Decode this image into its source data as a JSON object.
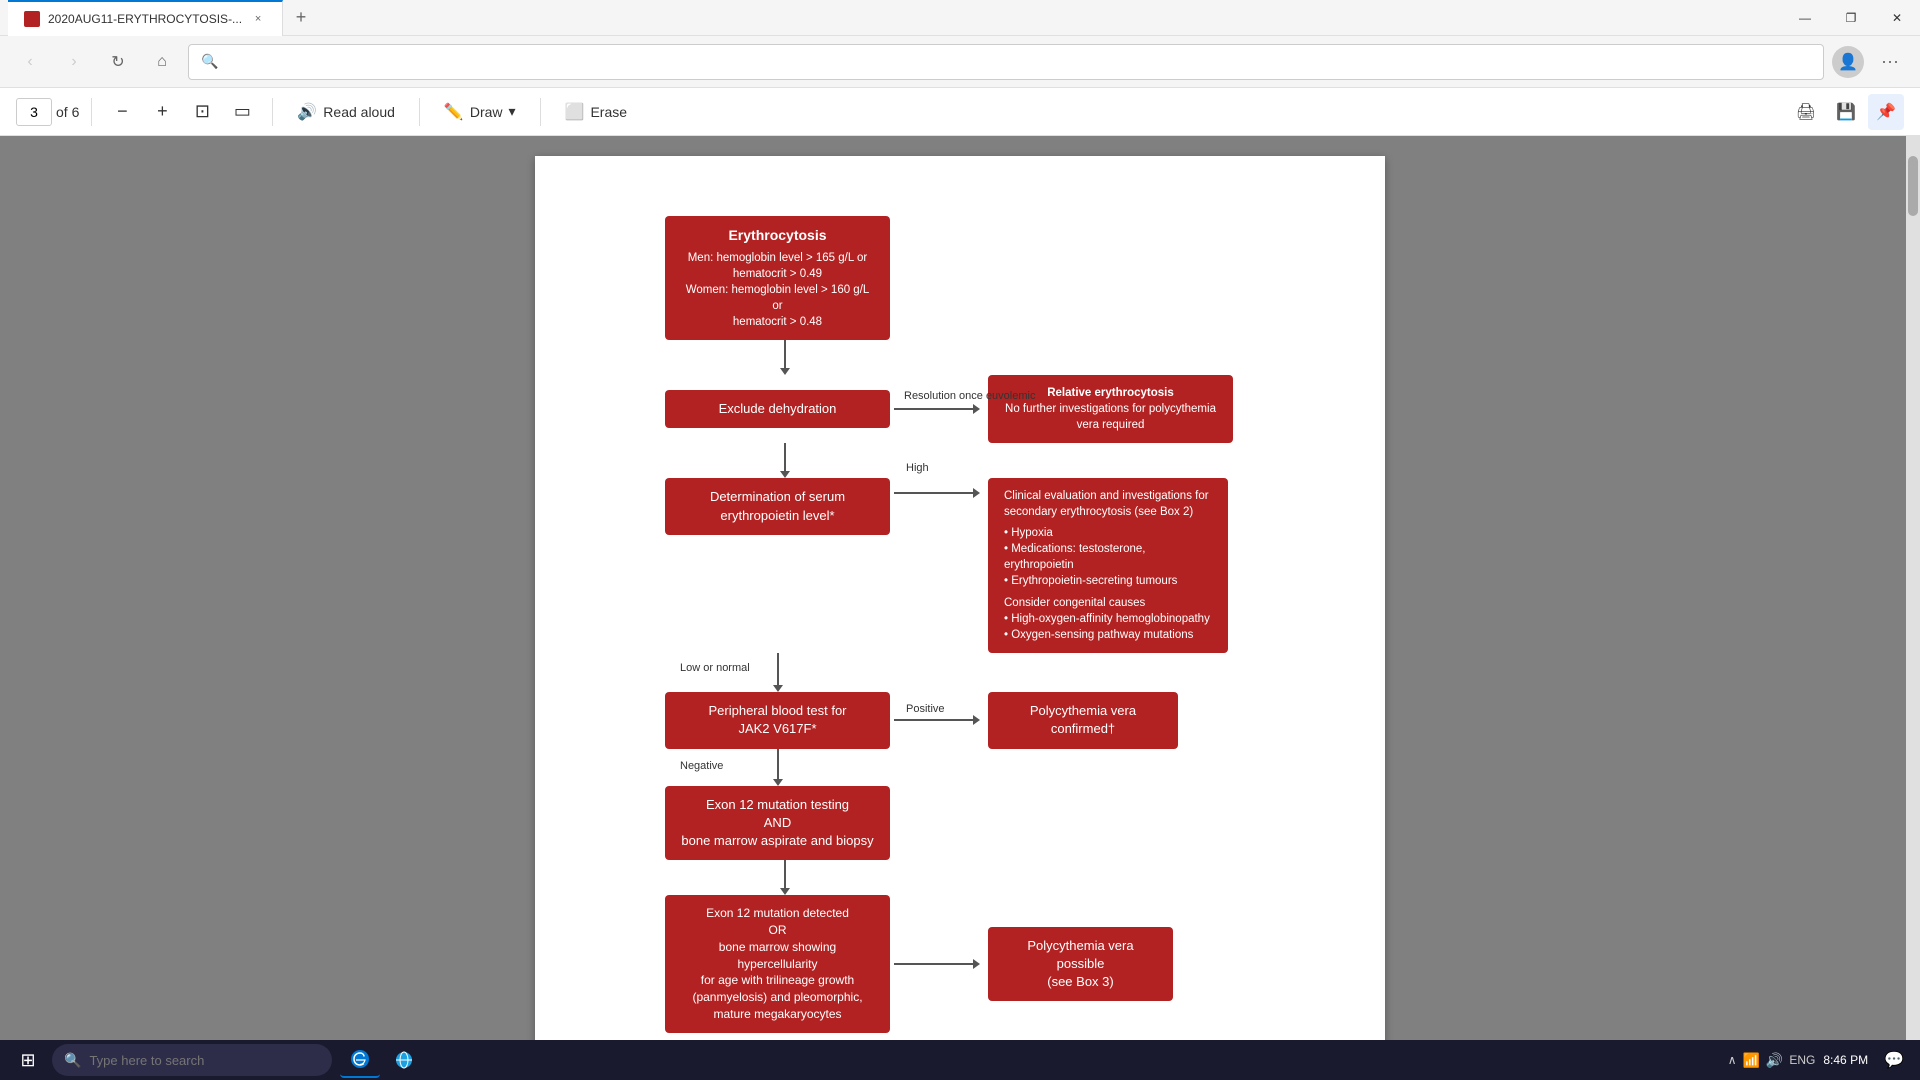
{
  "tab": {
    "title": "2020AUG11-ERYTHROCYTOSIS-...",
    "close_label": "×"
  },
  "new_tab": "+",
  "window_controls": {
    "minimize": "—",
    "maximize": "❐",
    "close": "✕"
  },
  "nav": {
    "back": "‹",
    "forward": "›",
    "refresh": "↻",
    "home": "⌂",
    "address": "",
    "more": "···"
  },
  "pdf_toolbar": {
    "page_current": "3",
    "page_total": "6",
    "zoom_out": "−",
    "zoom_in": "+",
    "fit_page": "⊡",
    "aspect": "▭",
    "read_aloud": "Read aloud",
    "draw": "Draw",
    "draw_chevron": "▾",
    "erase": "Erase",
    "print": "🖨",
    "save": "💾",
    "pin": "📌"
  },
  "flowchart": {
    "box1_line1": "Erythrocytosis",
    "box1_line2": "Men: hemoglobin level > 165 g/L or",
    "box1_line3": "hematocrit > 0.49",
    "box1_line4": "Women: hemoglobin level > 160 g/L or",
    "box1_line5": "hematocrit > 0.48",
    "box2": "Exclude dehydration",
    "label_resolution": "Resolution once euvolemic",
    "box3_line1": "Relative erythrocytosis",
    "box3_line2": "No further investigations for polycythemia",
    "box3_line3": "vera required",
    "box4_line1": "Determination of serum",
    "box4_line2": "erythropoietin level*",
    "label_high": "High",
    "box5_line1": "Clinical evaluation and investigations for",
    "box5_line2": "secondary erythrocytosis (see Box 2)",
    "box5_line3": "• Hypoxia",
    "box5_line4": "• Medications: testosterone, erythropoietin",
    "box5_line5": "• Erythropoietin-secreting tumours",
    "box5_line6": "Consider congenital causes",
    "box5_line7": "• High-oxygen-affinity hemoglobinopathy",
    "box5_line8": "• Oxygen-sensing pathway mutations",
    "label_low_normal": "Low or normal",
    "box6_line1": "Peripheral blood test for",
    "box6_line2": "JAK2 V617F*",
    "label_positive": "Positive",
    "box7": "Polycythemia vera confirmed†",
    "label_negative": "Negative",
    "box8_line1": "Exon 12 mutation testing",
    "box8_line2": "AND",
    "box8_line3": "bone marrow aspirate and biopsy",
    "box9_line1": "Exon 12 mutation detected",
    "box9_line2": "OR",
    "box9_line3": "bone marrow showing hypercellularity",
    "box9_line4": "for age with trilineage growth",
    "box9_line5": "(panmyelosis) and pleomorphic,",
    "box9_line6": "mature megakaryocytes",
    "box10_line1": "Polycythemia vera possible",
    "box10_line2": "(see Box 3)"
  },
  "taskbar": {
    "start_icon": "⊞",
    "search_placeholder": "Type here to search",
    "time": "8:46 PM",
    "date": "",
    "lang": "ENG",
    "apps": [
      "edge_active"
    ],
    "notification": "💬"
  }
}
